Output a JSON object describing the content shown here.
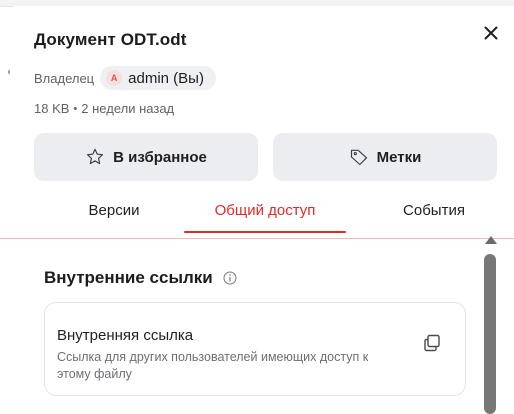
{
  "header": {
    "title": "Документ ODT.odt",
    "close_icon": "close-icon"
  },
  "owner": {
    "label": "Владелец",
    "avatar_letter": "A",
    "name": "admin (Вы)"
  },
  "meta": {
    "size": "18 KB",
    "separator": "•",
    "modified": "2 недели назад"
  },
  "actions": {
    "favorite_label": "В избранное",
    "favorite_icon": "star-icon",
    "tags_label": "Метки",
    "tags_icon": "tag-icon"
  },
  "tabs": {
    "versions": "Версии",
    "sharing": "Общий доступ",
    "events": "События",
    "active": "sharing",
    "accent_color": "#e02a2a"
  },
  "internal_links": {
    "title": "Внутренние ссылки",
    "info_icon": "info-icon",
    "card": {
      "title": "Внутренняя ссылка",
      "description": "Ссылка для других пользователей имеющих доступ к этому файлу",
      "copy_icon": "copy-icon"
    }
  }
}
